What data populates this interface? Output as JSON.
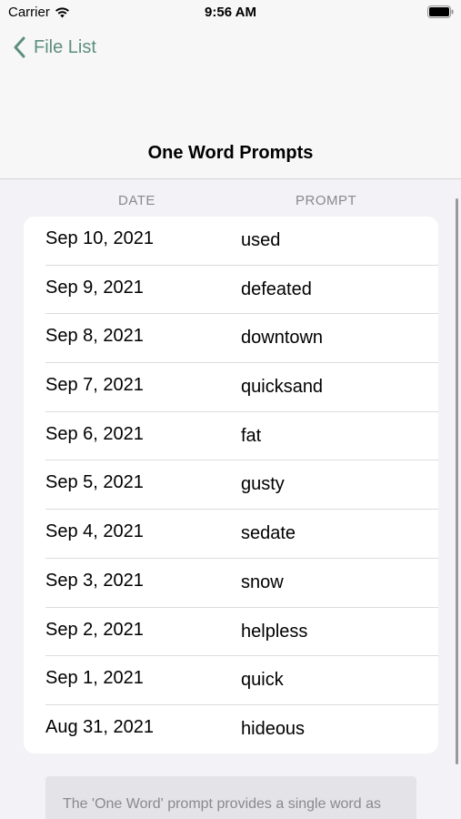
{
  "status_bar": {
    "carrier": "Carrier",
    "time": "9:56 AM",
    "icons": [
      "wifi-icon",
      "battery-icon"
    ]
  },
  "nav": {
    "back_label": "File List",
    "back_icon": "chevron-left-icon",
    "title": "One Word Prompts",
    "accent_color": "#5d8f7f"
  },
  "table": {
    "headers": {
      "date": "DATE",
      "prompt": "PROMPT"
    },
    "rows": [
      {
        "date": "Sep 10, 2021",
        "prompt": "used"
      },
      {
        "date": "Sep 9, 2021",
        "prompt": "defeated"
      },
      {
        "date": "Sep 8, 2021",
        "prompt": "downtown"
      },
      {
        "date": "Sep 7, 2021",
        "prompt": "quicksand"
      },
      {
        "date": "Sep 6, 2021",
        "prompt": "fat"
      },
      {
        "date": "Sep 5, 2021",
        "prompt": "gusty"
      },
      {
        "date": "Sep 4, 2021",
        "prompt": "sedate"
      },
      {
        "date": "Sep 3, 2021",
        "prompt": "snow"
      },
      {
        "date": "Sep 2, 2021",
        "prompt": "helpless"
      },
      {
        "date": "Sep 1, 2021",
        "prompt": "quick"
      },
      {
        "date": "Aug 31, 2021",
        "prompt": "hideous"
      }
    ]
  },
  "footer": {
    "note": "The 'One Word' prompt provides a single word as"
  }
}
